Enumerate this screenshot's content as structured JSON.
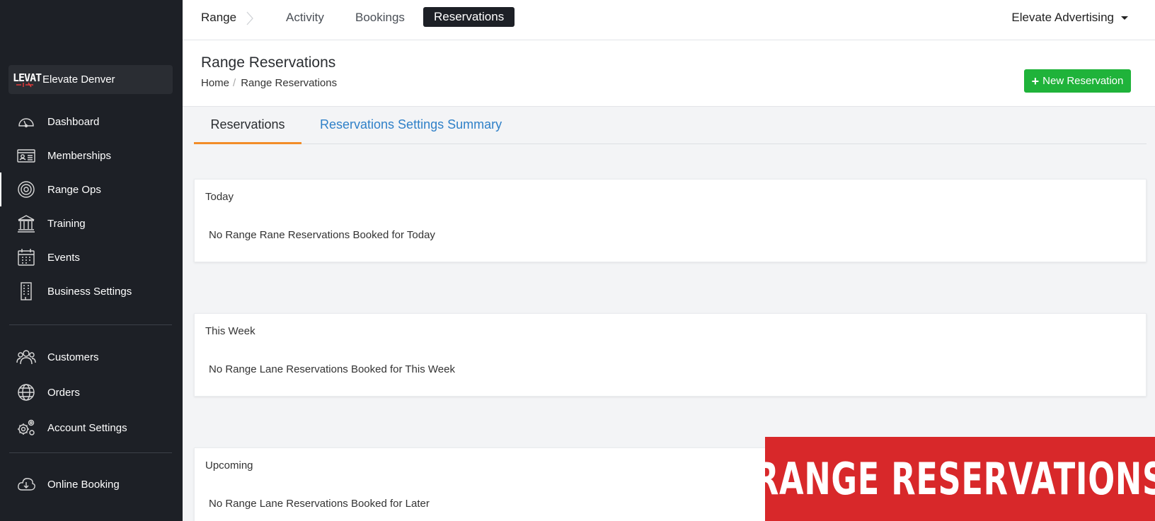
{
  "sidebar": {
    "org_name": "Elevate Denver",
    "logo_text": "LEVAT",
    "nav": [
      {
        "label": "Dashboard",
        "icon": "gauge-icon"
      },
      {
        "label": "Memberships",
        "icon": "id-card-icon"
      },
      {
        "label": "Range Ops",
        "icon": "target-icon"
      },
      {
        "label": "Training",
        "icon": "institution-icon"
      },
      {
        "label": "Events",
        "icon": "calendar-icon"
      },
      {
        "label": "Business Settings",
        "icon": "building-icon"
      },
      {
        "label": "Customers",
        "icon": "users-icon"
      },
      {
        "label": "Orders",
        "icon": "globe-icon"
      },
      {
        "label": "Account Settings",
        "icon": "gears-icon"
      },
      {
        "label": "Online Booking",
        "icon": "cloud-download-icon"
      }
    ]
  },
  "topbar": {
    "section": "Range",
    "tabs": [
      "Activity",
      "Bookings",
      "Reservations"
    ],
    "active_tab": "Reservations",
    "account": "Elevate Advertising"
  },
  "header": {
    "title": "Range Reservations",
    "breadcrumb": [
      "Home",
      "Range Reservations"
    ],
    "new_button": "New Reservation"
  },
  "tabs": {
    "reservations": "Reservations",
    "settings_summary": "Reservations Settings Summary"
  },
  "cards": [
    {
      "title": "Today",
      "message": "No Range Rane Reservations Booked for Today"
    },
    {
      "title": "This Week",
      "message": "No Range Lane Reservations Booked for This Week"
    },
    {
      "title": "Upcoming",
      "message": "No Range Lane Reservations Booked for Later"
    }
  ],
  "banner": {
    "text": "RANGE RESERVATIONS"
  },
  "colors": {
    "sidebar_bg": "#1d2026",
    "accent_green": "#1fb33a",
    "tab_underline": "#f28c28",
    "link_blue": "#2f80c8",
    "banner_red": "#d8282a"
  }
}
